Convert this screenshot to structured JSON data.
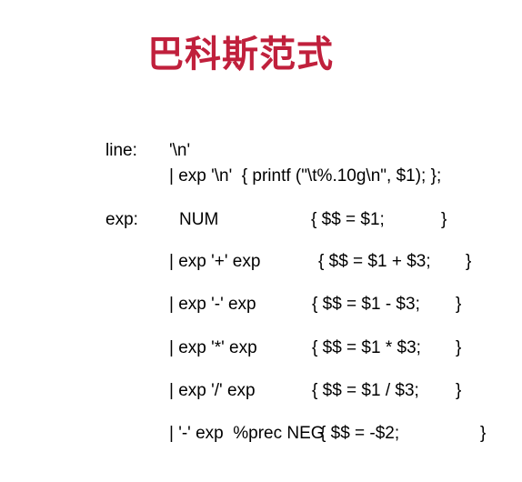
{
  "title": "巴科斯范式",
  "title_color": "#c0203c",
  "grammar": {
    "line_label": "line:",
    "line_rule_1": "'\\n'",
    "line_rule_2": "| exp '\\n'  { printf (\"\\t%.10g\\n\", $1); };",
    "exp_label": "exp:",
    "exp_rules": [
      {
        "pattern": "NUM",
        "action": "{ $$ = $1;",
        "close": "}"
      },
      {
        "pattern": "| exp '+' exp",
        "action": "{ $$ = $1 + $3;",
        "close": "}"
      },
      {
        "pattern": "| exp '-' exp",
        "action": "{ $$ = $1 - $3;",
        "close": "}"
      },
      {
        "pattern": "| exp '*' exp",
        "action": "{ $$ = $1 * $3;",
        "close": "}"
      },
      {
        "pattern": "| exp '/' exp",
        "action": "{ $$ = $1 / $3;",
        "close": "}"
      },
      {
        "pattern": "| '-' exp  %prec NEG",
        "action": "{ $$ = -$2;",
        "close": "}"
      }
    ]
  }
}
